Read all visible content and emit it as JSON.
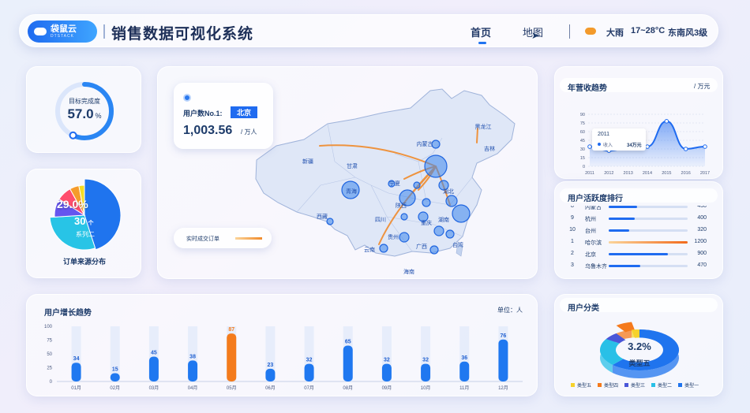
{
  "header": {
    "logo_text": "袋鼠云",
    "logo_sub": "DTSTACK",
    "title": "销售数据可视化系统",
    "nav": [
      {
        "label": "首页"
      },
      {
        "label": "地图"
      }
    ],
    "weather": {
      "condition": "大雨",
      "temperature": "17~28°C",
      "wind": "东南风3级"
    }
  },
  "target": {
    "label": "目标完成度",
    "value": "57.0",
    "unit": "%",
    "progress": 0.57
  },
  "order_source": {
    "title": "订单来源分布",
    "big_percent": "29.0",
    "percent_unit": "%",
    "count": "30",
    "count_unit": "个",
    "series_label": "系列二",
    "slices": [
      {
        "value": 45,
        "color": "#1f74ee"
      },
      {
        "value": 29,
        "color": "#28c4e6"
      },
      {
        "value": 10,
        "color": "#6555ef"
      },
      {
        "value": 8,
        "color": "#ff4d6d"
      },
      {
        "value": 5,
        "color": "#f59b2b"
      },
      {
        "value": 3,
        "color": "#f4dd23"
      }
    ]
  },
  "map": {
    "top_label": "用户数No.1:",
    "top_city": "北京",
    "top_value": "1,003.56",
    "top_unit": "/ 万人",
    "legend_label": "实时成交订单",
    "provinces": [
      "内蒙古",
      "黑龙江",
      "吉林",
      "新疆",
      "甘肃",
      "青海",
      "宁夏",
      "陕西",
      "西藏",
      "四川",
      "湖北",
      "重庆",
      "贵州",
      "云南",
      "广西",
      "湖南",
      "台湾",
      "海南"
    ]
  },
  "user_growth": {
    "title": "用户增长趋势",
    "unit_label": "单位：人",
    "chart_data": {
      "type": "bar",
      "categories": [
        "01月",
        "02月",
        "03月",
        "04月",
        "05月",
        "06月",
        "07月",
        "08月",
        "09月",
        "10月",
        "11月",
        "12月"
      ],
      "values": [
        34,
        15,
        45,
        38,
        87,
        23,
        32,
        65,
        32,
        32,
        36,
        76
      ],
      "ylim": [
        0,
        100
      ],
      "yticks": [
        0,
        25,
        50,
        75,
        100
      ],
      "highlight_index": 4
    }
  },
  "revenue": {
    "title": "年营收趋势",
    "unit": "/ 万元",
    "tooltip": {
      "year": "2011",
      "label": "收入",
      "value": "34万元"
    },
    "chart_data": {
      "type": "line",
      "x": [
        "2011",
        "2012",
        "2013",
        "2014",
        "2015",
        "2016",
        "2017"
      ],
      "values": [
        34,
        27,
        32,
        34,
        78,
        30,
        34
      ],
      "ylim": [
        0,
        90
      ],
      "yticks": [
        0,
        15,
        30,
        45,
        60,
        75,
        90
      ]
    }
  },
  "activity": {
    "title": "用户活跃度排行",
    "rows": [
      {
        "rank": "8",
        "name": "内蒙古",
        "value": "430",
        "pct": 0.36,
        "hot": false
      },
      {
        "rank": "9",
        "name": "杭州",
        "value": "400",
        "pct": 0.33,
        "hot": false
      },
      {
        "rank": "10",
        "name": "台州",
        "value": "320",
        "pct": 0.26,
        "hot": false
      },
      {
        "rank": "1",
        "name": "哈尔滨",
        "value": "1200",
        "pct": 1.0,
        "hot": true
      },
      {
        "rank": "2",
        "name": "北京",
        "value": "900",
        "pct": 0.75,
        "hot": false
      },
      {
        "rank": "3",
        "name": "乌鲁木齐",
        "value": "470",
        "pct": 0.4,
        "hot": false
      }
    ]
  },
  "user_category": {
    "title": "用户分类",
    "center_value": "3.2%",
    "center_label": "类型五",
    "legend": [
      {
        "name": "类型五",
        "color": "#f6d22c"
      },
      {
        "name": "类型四",
        "color": "#f57a1c"
      },
      {
        "name": "类型三",
        "color": "#4a56d8"
      },
      {
        "name": "类型二",
        "color": "#29c0e7"
      },
      {
        "name": "类型一",
        "color": "#1f74ee"
      }
    ],
    "slices": [
      {
        "value": 62,
        "color": "#1f74ee"
      },
      {
        "value": 22,
        "color": "#29c0e7"
      },
      {
        "value": 6,
        "color": "#4a56d8"
      },
      {
        "value": 6.8,
        "color": "#f57a1c"
      },
      {
        "value": 3.2,
        "color": "#f6d22c"
      }
    ]
  }
}
